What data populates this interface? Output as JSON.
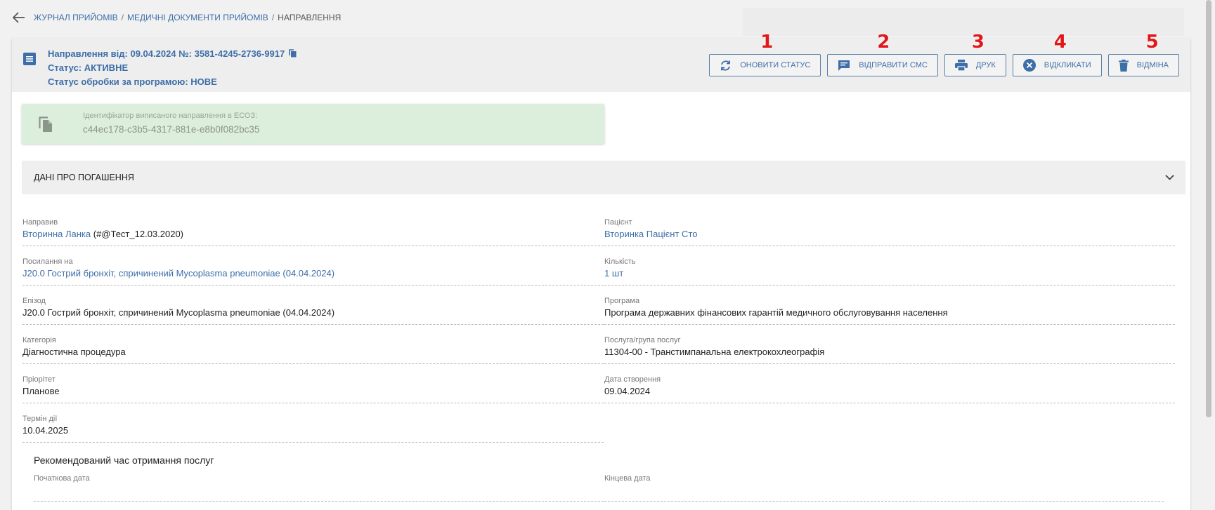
{
  "breadcrumb": {
    "items": [
      "ЖУРНАЛ ПРИЙОМІВ",
      "МЕДИЧНІ ДОКУМЕНТИ ПРИЙОМІВ",
      "НАПРАВЛЕННЯ"
    ],
    "separator": "/"
  },
  "header": {
    "title": "Направлення від: 09.04.2024 №: 3581-4245-2736-9917",
    "status": "Статус: АКТИВНЕ",
    "program_status": "Статус обробки за програмою: НОВЕ"
  },
  "actions": [
    {
      "label": "ОНОВИТИ СТАТУС",
      "icon": "refresh-icon",
      "badge": "1"
    },
    {
      "label": "ВІДПРАВИТИ СМС",
      "icon": "message-icon",
      "badge": "2"
    },
    {
      "label": "ДРУК",
      "icon": "print-icon",
      "badge": "3"
    },
    {
      "label": "ВІДКЛИКАТИ",
      "icon": "cancel-circle-icon",
      "badge": "4"
    },
    {
      "label": "ВІДМІНА",
      "icon": "trash-icon",
      "badge": "5"
    }
  ],
  "id_box": {
    "label": "Ідентифікатор виписаного направлення в ЕСОЗ:",
    "value": "c44ec178-c3b5-4317-881e-e8b0f082bc35"
  },
  "section": {
    "title": "ДАНІ ПРО ПОГАШЕННЯ"
  },
  "fields_left": [
    {
      "label": "Направив",
      "value": "Вторинна Ланка",
      "suffix": " (#@Тест_12.03.2020)",
      "link": true
    },
    {
      "label": "Посилання на",
      "value": "J20.0 Гострий бронхіт, спричинений Mycoplasma pneumoniae (04.04.2024)",
      "suffix": "",
      "link": true
    },
    {
      "label": "Епізод",
      "value": "J20.0 Гострий бронхіт, спричинений Mycoplasma pneumoniae (04.04.2024)",
      "suffix": "",
      "link": false
    },
    {
      "label": "Категорія",
      "value": "Діагностична процедура",
      "suffix": "",
      "link": false
    },
    {
      "label": "Пріорітет",
      "value": "Планове",
      "suffix": "",
      "link": false
    },
    {
      "label": "Термін дії",
      "value": "10.04.2025",
      "suffix": "",
      "link": false
    }
  ],
  "fields_right": [
    {
      "label": "Пацієнт",
      "value": "Вторинка Пацієнт Сто",
      "link": true
    },
    {
      "label": "Кількість",
      "value": "1 шт",
      "link": true
    },
    {
      "label": "Програма",
      "value": "Програма державних фінансових гарантій медичного обслуговування населення",
      "link": false
    },
    {
      "label": "Послуга/група послуг",
      "value": "11304-00 - Транстимпанальна електрокохлеографія",
      "link": false
    },
    {
      "label": "Дата створення",
      "value": "09.04.2024",
      "link": false
    }
  ],
  "recommended": {
    "title": "Рекомендований час отримання послуг",
    "start_label": "Початкова дата",
    "end_label": "Кінцева дата"
  },
  "colors": {
    "accent": "#3d6ea8",
    "badge_red": "#e0181c",
    "id_box_bg": "#dcefdc"
  }
}
